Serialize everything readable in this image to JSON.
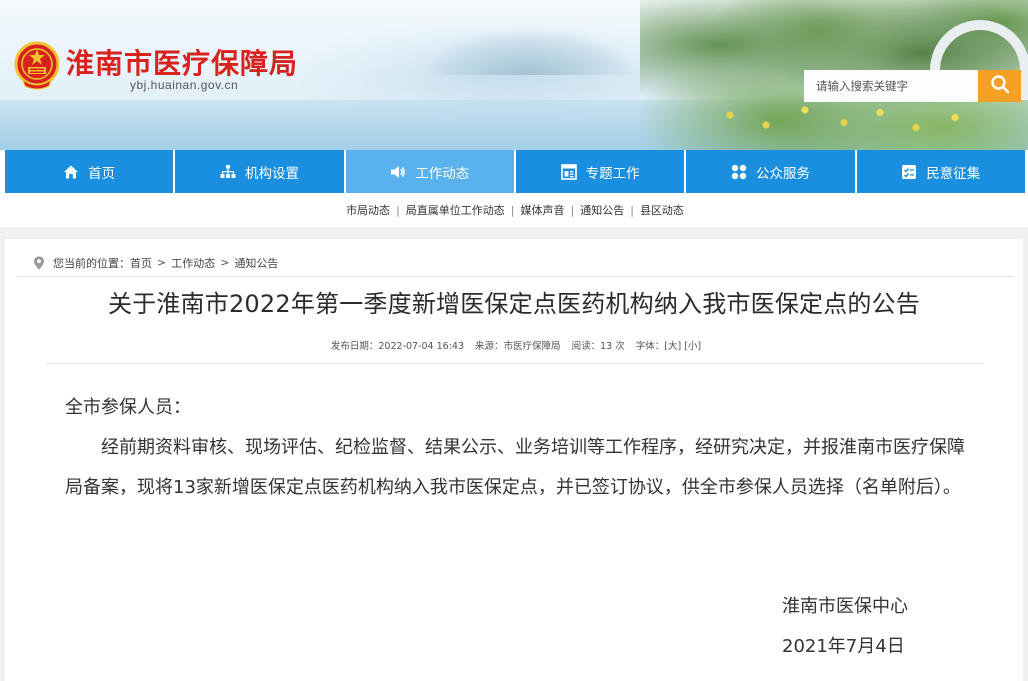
{
  "site": {
    "title": "淮南市医疗保障局",
    "domain": "ybj.huainan.gov.cn"
  },
  "search": {
    "placeholder": "请输入搜索关键字"
  },
  "nav": {
    "items": [
      {
        "label": "首页",
        "icon": "home-icon"
      },
      {
        "label": "机构设置",
        "icon": "org-chart-icon"
      },
      {
        "label": "工作动态",
        "icon": "speaker-icon",
        "active": true
      },
      {
        "label": "专题工作",
        "icon": "document-icon"
      },
      {
        "label": "公众服务",
        "icon": "grid-icon"
      },
      {
        "label": "民意征集",
        "icon": "checklist-icon"
      }
    ]
  },
  "subnav": {
    "items": [
      "市局动态",
      "局直属单位工作动态",
      "媒体声音",
      "通知公告",
      "县区动态"
    ],
    "separator": "|"
  },
  "breadcrumb": {
    "prefix": "您当前的位置：",
    "items": [
      "首页",
      "工作动态",
      "通知公告"
    ],
    "separator": ">"
  },
  "article": {
    "title": "关于淮南市2022年第一季度新增医保定点医药机构纳入我市医保定点的公告",
    "meta": {
      "date": "发布日期：2022-07-04 16:43",
      "source": "来源：市医疗保障局",
      "views": "阅读：13 次",
      "font_label": "字体：",
      "font_large": "[大]",
      "font_small": "[小]"
    },
    "salutation": "全市参保人员：",
    "body": "经前期资料审核、现场评估、纪检监督、结果公示、业务培训等工作程序，经研究决定，并报淮南市医疗保障局备案，现将13家新增医保定点医药机构纳入我市医保定点，并已签订协议，供全市参保人员选择（名单附后）。",
    "signature": {
      "org": "淮南市医保中心",
      "date": "2021年7月4日"
    }
  },
  "colors": {
    "title_red": "#d7221d",
    "nav_blue": "#1a8fe0",
    "nav_active": "#59b2ee",
    "search_orange": "#f4a025"
  }
}
